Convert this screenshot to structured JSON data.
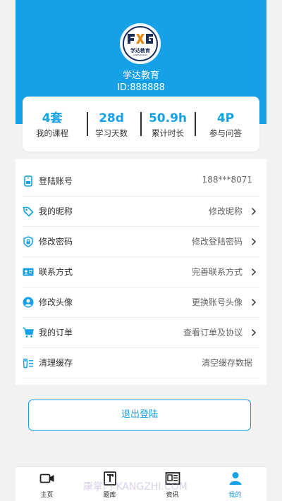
{
  "header": {
    "logo_text": "学达教育",
    "logo_sub": "XUEDAJIAOYU",
    "org_name": "学达教育",
    "org_id": "ID:888888"
  },
  "stats": [
    {
      "value": "4套",
      "label": "我的课程"
    },
    {
      "value": "28d",
      "label": "学习天数"
    },
    {
      "value": "50.9h",
      "label": "累计时长"
    },
    {
      "value": "4P",
      "label": "参与问答"
    }
  ],
  "settings": [
    {
      "icon": "phone-icon",
      "label": "登陆账号",
      "value": "188***8071"
    },
    {
      "icon": "tag-icon",
      "label": "我的昵称",
      "value": "修改昵称"
    },
    {
      "icon": "shield-lock-icon",
      "label": "修改密码",
      "value": "修改登陆密码"
    },
    {
      "icon": "contact-card-icon",
      "label": "联系方式",
      "value": "完善联系方式"
    },
    {
      "icon": "user-circle-icon",
      "label": "修改头像",
      "value": "更换账号头像"
    },
    {
      "icon": "cart-icon",
      "label": "我的订单",
      "value": "查看订单及协议"
    },
    {
      "icon": "clear-cache-icon",
      "label": "清理缓存",
      "value": "清空缓存数据"
    }
  ],
  "logout_label": "退出登陆",
  "tabs": [
    {
      "icon": "video-camera-icon",
      "label": "主页"
    },
    {
      "icon": "question-bank-icon",
      "label": "题库"
    },
    {
      "icon": "news-icon",
      "label": "资讯"
    },
    {
      "icon": "person-icon",
      "label": "我的"
    }
  ],
  "watermark": "康掌门 KANGZHI.COM",
  "colors": {
    "accent": "#16a0e6",
    "background": "#f2f2f2"
  }
}
